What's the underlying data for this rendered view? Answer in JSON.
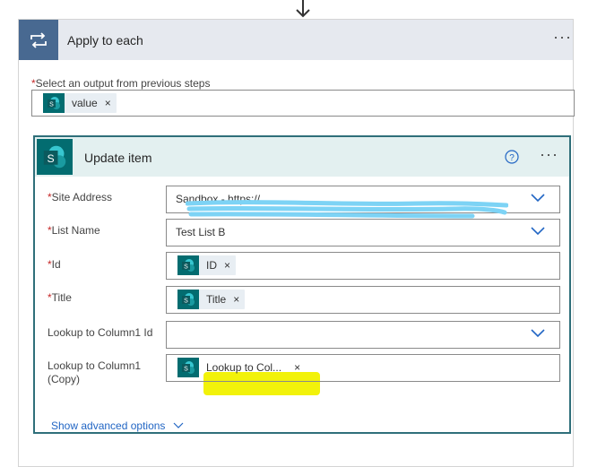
{
  "apply_each": {
    "title": "Apply to each",
    "menu": "···",
    "output_label": "Select an output from previous steps",
    "output_token": {
      "label": "value",
      "remove": "×",
      "icon": "sharepoint-icon"
    }
  },
  "update_item": {
    "title": "Update item",
    "menu": "···",
    "help_icon": "question-circle-icon",
    "fields": {
      "site_address": {
        "label": "Site Address",
        "value": "Sandbox - https://",
        "required": true
      },
      "list_name": {
        "label": "List Name",
        "value": "Test List B",
        "required": true
      },
      "id": {
        "label": "Id",
        "token": "ID",
        "remove": "×",
        "required": true
      },
      "title": {
        "label": "Title",
        "token": "Title",
        "remove": "×",
        "required": true
      },
      "lookup_id": {
        "label": "Lookup to Column1 Id",
        "value": ""
      },
      "lookup_copy": {
        "label_line1": "Lookup to Column1",
        "label_line2": "(Copy)",
        "token": "Lookup to Col...",
        "remove": "×"
      }
    },
    "advanced_label": "Show advanced options"
  },
  "colors": {
    "apply_header": "#e6e9ef",
    "apply_icon": "#486991",
    "sharepoint_teal": "#036c70",
    "update_border": "#2f6f7a",
    "update_header": "#e3f0f0",
    "link_blue": "#2266c4",
    "highlight": "#f2f20a",
    "scribble": "#7dd3f5"
  },
  "required_marker": "*"
}
